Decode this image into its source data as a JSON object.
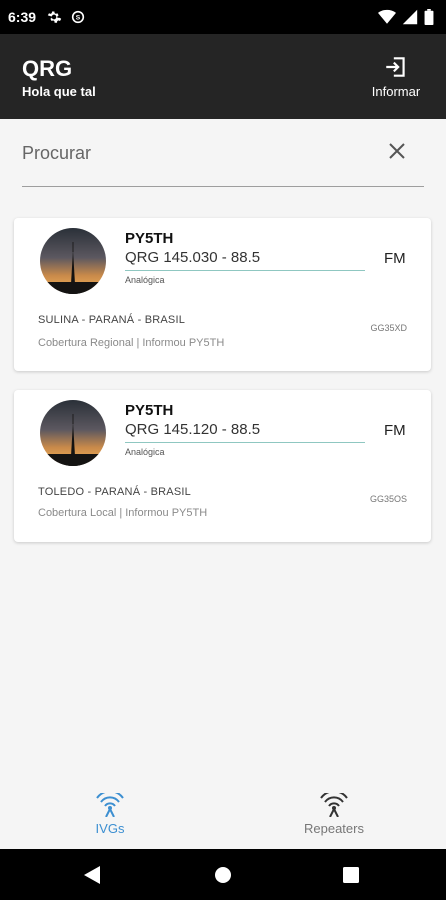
{
  "status_bar": {
    "time": "6:39"
  },
  "app_bar": {
    "title": "QRG",
    "subtitle": "Hola que tal",
    "report_label": "Informar"
  },
  "search": {
    "placeholder": "Procurar",
    "value": ""
  },
  "cards": [
    {
      "callsign": "PY5TH",
      "qrg": "QRG 145.030 - 88.5",
      "mode_type": "Analógica",
      "modulation": "FM",
      "location": "SULINA - PARANÁ - BRASIL",
      "coverage": "Cobertura Regional | Informou PY5TH",
      "grid_locator": "GG35XD"
    },
    {
      "callsign": "PY5TH",
      "qrg": "QRG 145.120 - 88.5",
      "mode_type": "Analógica",
      "modulation": "FM",
      "location": "TOLEDO - PARANÁ - BRASIL",
      "coverage": "Cobertura Local | Informou PY5TH",
      "grid_locator": "GG35OS"
    }
  ],
  "bottom_nav": {
    "items": [
      {
        "label": "IVGs",
        "active": true,
        "icon": "antenna-icon"
      },
      {
        "label": "Repeaters",
        "active": false,
        "icon": "antenna-icon"
      }
    ]
  },
  "colors": {
    "app_bar": "#252525",
    "accent": "#3c8fd1",
    "qrg_underline": "#8fc7c1",
    "background": "#f5f5f5"
  }
}
